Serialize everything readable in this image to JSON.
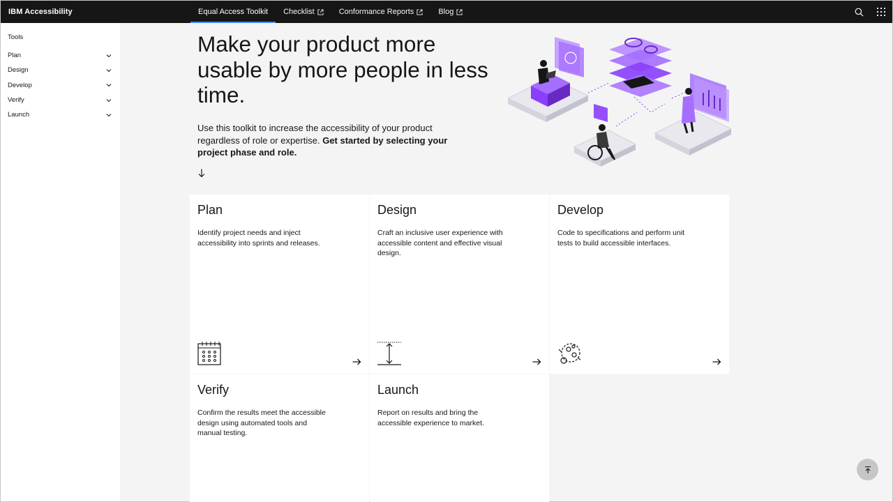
{
  "header": {
    "brand": "IBM Accessibility",
    "nav": [
      {
        "label": "Equal Access Toolkit",
        "active": true,
        "external": false
      },
      {
        "label": "Checklist",
        "active": false,
        "external": true
      },
      {
        "label": "Conformance Reports",
        "active": false,
        "external": true
      },
      {
        "label": "Blog",
        "active": false,
        "external": true
      }
    ],
    "icons": [
      "search-icon",
      "app-switcher-icon"
    ]
  },
  "sidebar": {
    "title": "Tools",
    "items": [
      {
        "label": "Plan"
      },
      {
        "label": "Design"
      },
      {
        "label": "Develop"
      },
      {
        "label": "Verify"
      },
      {
        "label": "Launch"
      }
    ]
  },
  "hero": {
    "title": "Make your product more usable by more people in less time.",
    "body_plain": "Use this toolkit to increase the accessibility of your product regardless of role or expertise. ",
    "body_bold": "Get started by selecting your project phase and role."
  },
  "cards": [
    {
      "title": "Plan",
      "desc": "Identify project needs and inject accessibility into sprints and releases.",
      "icon": "calendar-icon"
    },
    {
      "title": "Design",
      "desc": "Craft an inclusive user experience with accessible content and effective visual design.",
      "icon": "design-measure-icon"
    },
    {
      "title": "Develop",
      "desc": "Code to specifications and perform unit tests to build accessible interfaces.",
      "icon": "develop-cycle-icon"
    },
    {
      "title": "Verify",
      "desc": "Confirm the results meet the accessible design using automated tools and manual testing.",
      "icon": "verify-icon"
    },
    {
      "title": "Launch",
      "desc": "Report on results and bring the accessible experience to market.",
      "icon": "launch-icon"
    }
  ],
  "colors": {
    "header_bg": "#161616",
    "active_underline": "#4589ff",
    "page_bg": "#f4f4f4",
    "illustration_purple": "#8a3ffc"
  }
}
